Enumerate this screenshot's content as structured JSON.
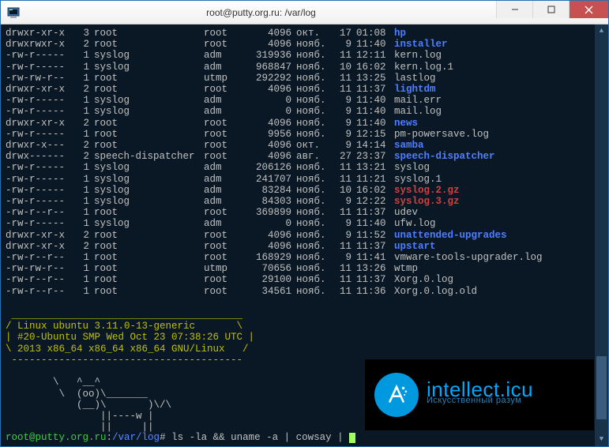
{
  "window": {
    "title": "root@putty.org.ru: /var/log"
  },
  "prompt": {
    "user_host": "root@putty.org.ru",
    "path": "/var/log",
    "command": "ls -la && uname -a | cowsay |"
  },
  "motd": {
    "line1": "/ Linux ubuntu 3.11.0-13-generic       \\",
    "line2": "| #20-Ubuntu SMP Wed Oct 23 07:38:26 UTC |",
    "line3": "\\ 2013 x86_64 x86_64 x86_64 GNU/Linux   /"
  },
  "ascii": {
    "l0": " _______________________________________",
    "l1": " ---------------------------------------",
    "l2": "        \\   ^__^",
    "l3": "         \\  (oo)\\_______",
    "l4": "            (__)\\       )\\/\\",
    "l5": "                ||----w |",
    "l6": "                ||     ||"
  },
  "listing": [
    {
      "perms": "drwxr-xr-x",
      "links": "3",
      "owner": "root",
      "group": "root",
      "size": "4096",
      "month": "окт.",
      "day": "17",
      "time": "01:08",
      "name": "hp",
      "cls": "dir"
    },
    {
      "perms": "drwxrwxr-x",
      "links": "2",
      "owner": "root",
      "group": "root",
      "size": "4096",
      "month": "нояб.",
      "day": "9",
      "time": "11:40",
      "name": "installer",
      "cls": "dir"
    },
    {
      "perms": "-rw-r-----",
      "links": "1",
      "owner": "syslog",
      "group": "adm",
      "size": "319936",
      "month": "нояб.",
      "day": "11",
      "time": "12:11",
      "name": "kern.log",
      "cls": "plain"
    },
    {
      "perms": "-rw-r-----",
      "links": "1",
      "owner": "syslog",
      "group": "adm",
      "size": "968847",
      "month": "нояб.",
      "day": "10",
      "time": "16:02",
      "name": "kern.log.1",
      "cls": "plain"
    },
    {
      "perms": "-rw-rw-r--",
      "links": "1",
      "owner": "root",
      "group": "utmp",
      "size": "292292",
      "month": "нояб.",
      "day": "11",
      "time": "13:25",
      "name": "lastlog",
      "cls": "plain"
    },
    {
      "perms": "drwxr-xr-x",
      "links": "2",
      "owner": "root",
      "group": "root",
      "size": "4096",
      "month": "нояб.",
      "day": "11",
      "time": "11:37",
      "name": "lightdm",
      "cls": "dir"
    },
    {
      "perms": "-rw-r-----",
      "links": "1",
      "owner": "syslog",
      "group": "adm",
      "size": "0",
      "month": "нояб.",
      "day": "9",
      "time": "11:40",
      "name": "mail.err",
      "cls": "plain"
    },
    {
      "perms": "-rw-r-----",
      "links": "1",
      "owner": "syslog",
      "group": "adm",
      "size": "0",
      "month": "нояб.",
      "day": "9",
      "time": "11:40",
      "name": "mail.log",
      "cls": "plain"
    },
    {
      "perms": "drwxr-xr-x",
      "links": "2",
      "owner": "root",
      "group": "root",
      "size": "4096",
      "month": "нояб.",
      "day": "9",
      "time": "11:40",
      "name": "news",
      "cls": "dir"
    },
    {
      "perms": "-rw-r-----",
      "links": "1",
      "owner": "root",
      "group": "root",
      "size": "9956",
      "month": "нояб.",
      "day": "9",
      "time": "12:15",
      "name": "pm-powersave.log",
      "cls": "plain"
    },
    {
      "perms": "drwxr-x---",
      "links": "2",
      "owner": "root",
      "group": "root",
      "size": "4096",
      "month": "окт.",
      "day": "9",
      "time": "14:14",
      "name": "samba",
      "cls": "dir"
    },
    {
      "perms": "drwx------",
      "links": "2",
      "owner": "speech-dispatcher",
      "group": "root",
      "size": "4096",
      "month": "авг.",
      "day": "27",
      "time": "23:37",
      "name": "speech-dispatcher",
      "cls": "dir"
    },
    {
      "perms": "-rw-r-----",
      "links": "1",
      "owner": "syslog",
      "group": "adm",
      "size": "206126",
      "month": "нояб.",
      "day": "11",
      "time": "13:21",
      "name": "syslog",
      "cls": "plain"
    },
    {
      "perms": "-rw-r-----",
      "links": "1",
      "owner": "syslog",
      "group": "adm",
      "size": "241707",
      "month": "нояб.",
      "day": "11",
      "time": "11:21",
      "name": "syslog.1",
      "cls": "plain"
    },
    {
      "perms": "-rw-r-----",
      "links": "1",
      "owner": "syslog",
      "group": "adm",
      "size": "83284",
      "month": "нояб.",
      "day": "10",
      "time": "16:02",
      "name": "syslog.2.gz",
      "cls": "ar"
    },
    {
      "perms": "-rw-r-----",
      "links": "1",
      "owner": "syslog",
      "group": "adm",
      "size": "84303",
      "month": "нояб.",
      "day": "9",
      "time": "12:22",
      "name": "syslog.3.gz",
      "cls": "ar"
    },
    {
      "perms": "-rw-r--r--",
      "links": "1",
      "owner": "root",
      "group": "root",
      "size": "369899",
      "month": "нояб.",
      "day": "11",
      "time": "11:37",
      "name": "udev",
      "cls": "plain"
    },
    {
      "perms": "-rw-r-----",
      "links": "1",
      "owner": "syslog",
      "group": "adm",
      "size": "0",
      "month": "нояб.",
      "day": "9",
      "time": "11:40",
      "name": "ufw.log",
      "cls": "plain"
    },
    {
      "perms": "drwxr-xr-x",
      "links": "2",
      "owner": "root",
      "group": "root",
      "size": "4096",
      "month": "нояб.",
      "day": "9",
      "time": "11:52",
      "name": "unattended-upgrades",
      "cls": "dir"
    },
    {
      "perms": "drwxr-xr-x",
      "links": "2",
      "owner": "root",
      "group": "root",
      "size": "4096",
      "month": "нояб.",
      "day": "11",
      "time": "11:37",
      "name": "upstart",
      "cls": "dir"
    },
    {
      "perms": "-rw-r--r--",
      "links": "1",
      "owner": "root",
      "group": "root",
      "size": "168929",
      "month": "нояб.",
      "day": "9",
      "time": "11:41",
      "name": "vmware-tools-upgrader.log",
      "cls": "plain"
    },
    {
      "perms": "-rw-rw-r--",
      "links": "1",
      "owner": "root",
      "group": "utmp",
      "size": "70656",
      "month": "нояб.",
      "day": "11",
      "time": "13:26",
      "name": "wtmp",
      "cls": "plain"
    },
    {
      "perms": "-rw-r--r--",
      "links": "1",
      "owner": "root",
      "group": "root",
      "size": "29100",
      "month": "нояб.",
      "day": "11",
      "time": "11:37",
      "name": "Xorg.0.log",
      "cls": "plain"
    },
    {
      "perms": "-rw-r--r--",
      "links": "1",
      "owner": "root",
      "group": "root",
      "size": "34561",
      "month": "нояб.",
      "day": "11",
      "time": "11:36",
      "name": "Xorg.0.log.old",
      "cls": "plain"
    }
  ],
  "watermark": {
    "line1": "intellect.icu",
    "line2": "Искусственный разум"
  }
}
